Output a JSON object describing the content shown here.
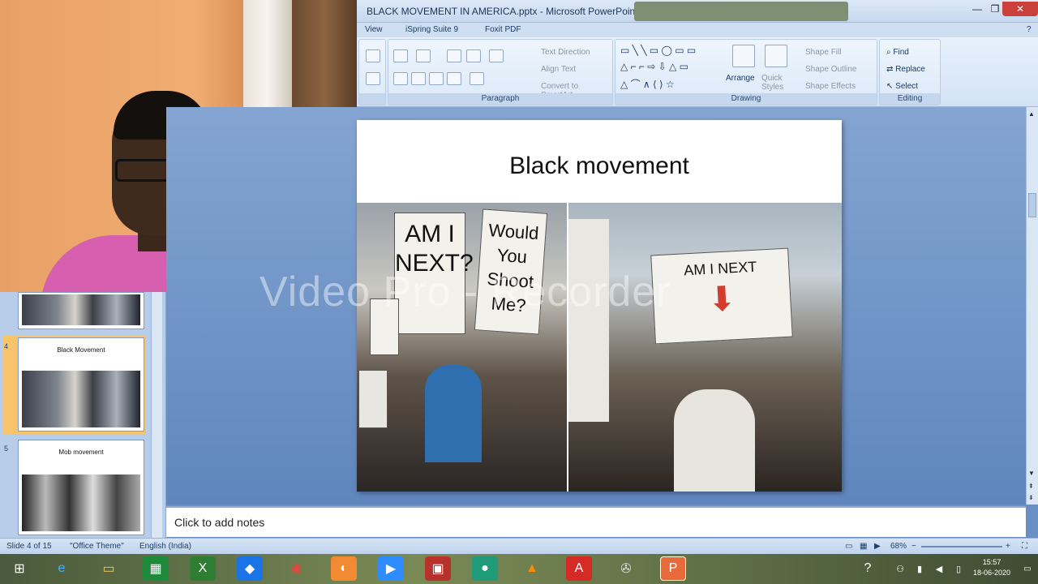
{
  "window": {
    "title": "BLACK MOVEMENT IN AMERICA.pptx - Microsoft PowerPoint"
  },
  "ribbon": {
    "tabs": [
      "View",
      "iSpring Suite 9",
      "Foxit PDF"
    ],
    "paragraph": {
      "label": "Paragraph",
      "text_direction": "Text Direction",
      "align_text": "Align Text",
      "convert_smartart": "Convert to SmartArt"
    },
    "drawing": {
      "label": "Drawing",
      "arrange": "Arrange",
      "quick_styles": "Quick Styles",
      "shape_fill": "Shape Fill",
      "shape_outline": "Shape Outline",
      "shape_effects": "Shape Effects"
    },
    "editing": {
      "label": "Editing",
      "find": "Find",
      "replace": "Replace",
      "select": "Select"
    }
  },
  "slides_pane": {
    "thumbnails": [
      {
        "number": "",
        "title": ""
      },
      {
        "number": "4",
        "title": "Black Movement"
      },
      {
        "number": "5",
        "title": "Mob movement"
      }
    ]
  },
  "slide": {
    "title": "Black movement",
    "sign_texts": {
      "am_i_next": "AM I NEXT?",
      "would_you_shoot_me": "Would You Shoot Me?",
      "am_i_next_2": "AM I NEXT"
    }
  },
  "watermark": "Video Pro - Recorder",
  "notes": {
    "placeholder": "Click to add notes"
  },
  "statusbar": {
    "slide_info": "Slide 4 of 15",
    "theme": "\"Office Theme\"",
    "language": "English (India)",
    "zoom": "68%"
  },
  "taskbar": {
    "time": "15:57",
    "date": "18-06-2020"
  },
  "colors": {
    "ribbon_bg": "#dce9f8",
    "slide_bg": "#5f86bd",
    "close_button": "#c9413a"
  }
}
